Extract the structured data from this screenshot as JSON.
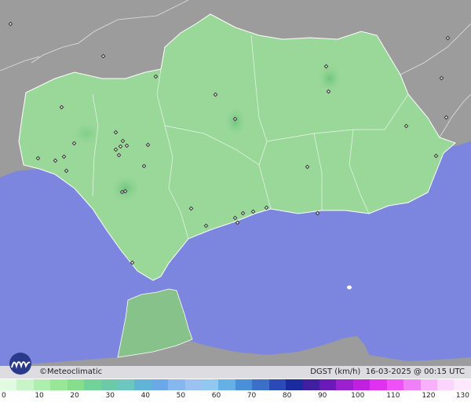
{
  "brand": {
    "copyright": "©",
    "name": "Meteoclimatic"
  },
  "info": {
    "variable": "DGST (km/h)",
    "timestamp": "16-03-2025 @ 00:15 UTC"
  },
  "colors": {
    "sea": "#7d86de",
    "land_outside": "#9c9c9c",
    "andalucia": "#9ad89a",
    "ceuta": "#86c28a",
    "border": "#ffffff",
    "station": "#333333"
  },
  "legend": {
    "ticks": [
      "0",
      "10",
      "20",
      "30",
      "40",
      "50",
      "60",
      "70",
      "80",
      "90",
      "100",
      "110",
      "120",
      "130"
    ],
    "colors": [
      "#e0fbe0",
      "#c8f5c8",
      "#aeeeae",
      "#98e698",
      "#86dd8c",
      "#72d39a",
      "#6dcaa8",
      "#6cc7c0",
      "#5fb4d8",
      "#6aa8e8",
      "#86b8f0",
      "#9cc2f4",
      "#90c8f0",
      "#66b0e8",
      "#4a90d8",
      "#3c70c8",
      "#2a4ab8",
      "#1a2aa0",
      "#4020a0",
      "#6a1ab8",
      "#9a20d0",
      "#c020e0",
      "#e030f0",
      "#f050f8",
      "#f080fa",
      "#f8b0fc",
      "#fcd4fe",
      "#fee8ff"
    ]
  }
}
